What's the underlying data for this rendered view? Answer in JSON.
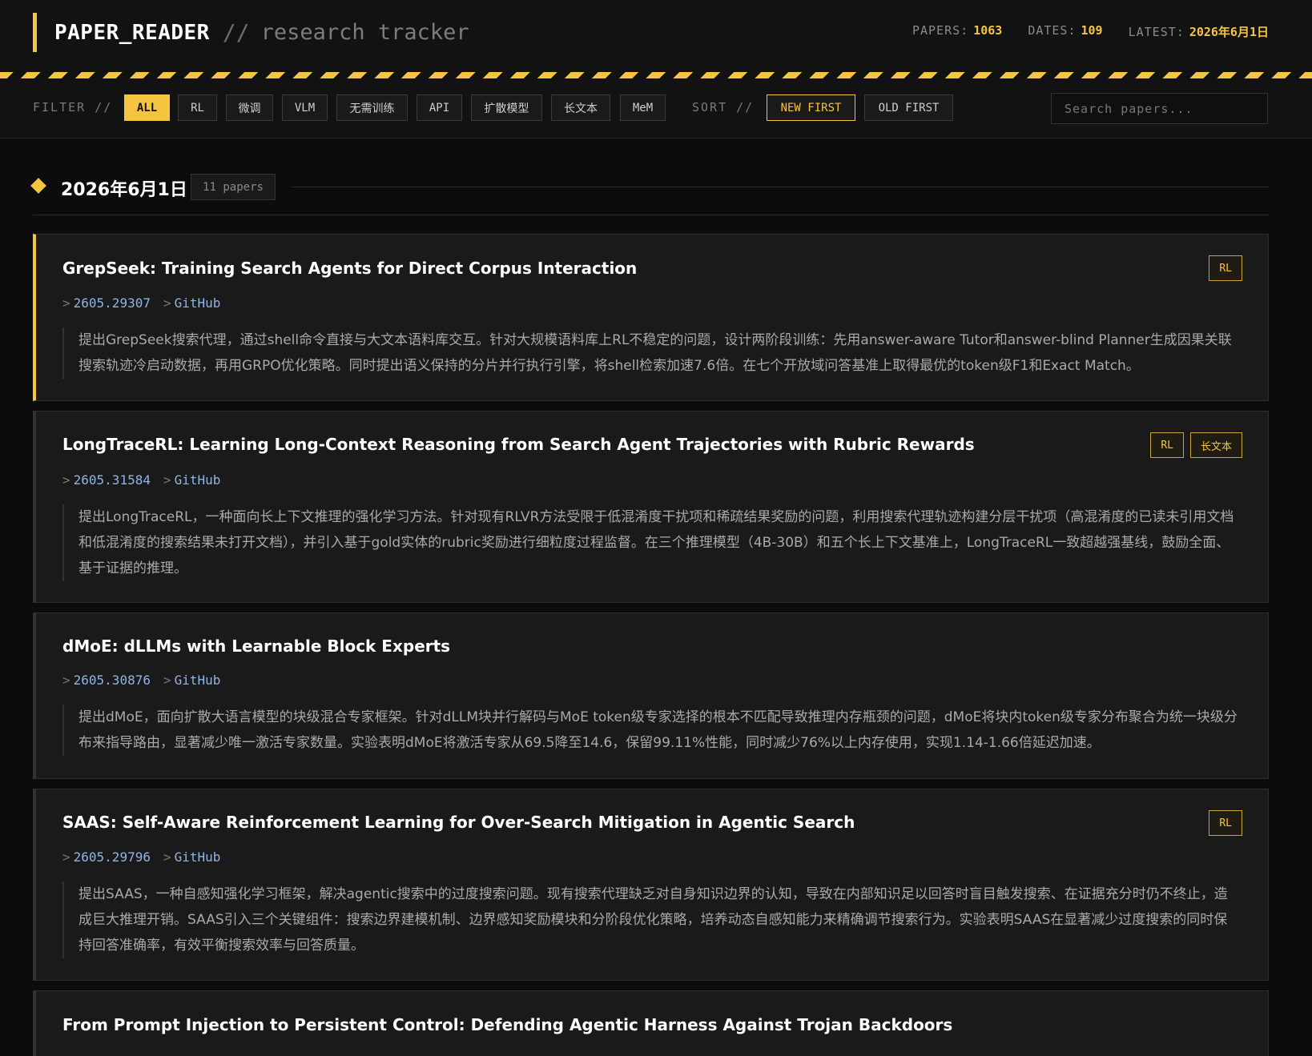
{
  "header": {
    "app_name": "PAPER_READER",
    "separator": "//",
    "subtitle": "research tracker",
    "stats": {
      "papers_label": "PAPERS:",
      "papers_value": "1063",
      "dates_label": "DATES:",
      "dates_value": "109",
      "latest_label": "LATEST:",
      "latest_value": "2026年6月1日"
    }
  },
  "filterbar": {
    "filter_label": "FILTER //",
    "filters": [
      "ALL",
      "RL",
      "微调",
      "VLM",
      "无需训练",
      "API",
      "扩散模型",
      "长文本",
      "MeM"
    ],
    "active_filter": "ALL",
    "sort_label": "SORT //",
    "sort_options": [
      "NEW FIRST",
      "OLD FIRST"
    ],
    "active_sort": "NEW FIRST",
    "search_placeholder": "Search papers..."
  },
  "date_group": {
    "date": "2026年6月1日",
    "count": "11 papers"
  },
  "papers": [
    {
      "title": "GrepSeek: Training Search Agents for Direct Corpus Interaction",
      "arxiv": "2605.29307",
      "github": "GitHub",
      "summary": "提出GrepSeek搜索代理，通过shell命令直接与大文本语料库交互。针对大规模语料库上RL不稳定的问题，设计两阶段训练：先用answer-aware Tutor和answer-blind Planner生成因果关联搜索轨迹冷启动数据，再用GRPO优化策略。同时提出语义保持的分片并行执行引擎，将shell检索加速7.6倍。在七个开放域问答基准上取得最优的token级F1和Exact Match。",
      "tags": [
        "RL"
      ]
    },
    {
      "title": "LongTraceRL: Learning Long-Context Reasoning from Search Agent Trajectories with Rubric Rewards",
      "arxiv": "2605.31584",
      "github": "GitHub",
      "summary": "提出LongTraceRL，一种面向长上下文推理的强化学习方法。针对现有RLVR方法受限于低混淆度干扰项和稀疏结果奖励的问题，利用搜索代理轨迹构建分层干扰项（高混淆度的已读未引用文档和低混淆度的搜索结果未打开文档），并引入基于gold实体的rubric奖励进行细粒度过程监督。在三个推理模型（4B-30B）和五个长上下文基准上，LongTraceRL一致超越强基线，鼓励全面、基于证据的推理。",
      "tags": [
        "RL",
        "长文本"
      ]
    },
    {
      "title": "dMoE: dLLMs with Learnable Block Experts",
      "arxiv": "2605.30876",
      "github": "GitHub",
      "summary": "提出dMoE，面向扩散大语言模型的块级混合专家框架。针对dLLM块并行解码与MoE token级专家选择的根本不匹配导致推理内存瓶颈的问题，dMoE将块内token级专家分布聚合为统一块级分布来指导路由，显著减少唯一激活专家数量。实验表明dMoE将激活专家从69.5降至14.6，保留99.11%性能，同时减少76%以上内存使用，实现1.14-1.66倍延迟加速。",
      "tags": []
    },
    {
      "title": "SAAS: Self-Aware Reinforcement Learning for Over-Search Mitigation in Agentic Search",
      "arxiv": "2605.29796",
      "github": "GitHub",
      "summary": "提出SAAS，一种自感知强化学习框架，解决agentic搜索中的过度搜索问题。现有搜索代理缺乏对自身知识边界的认知，导致在内部知识足以回答时盲目触发搜索、在证据充分时仍不终止，造成巨大推理开销。SAAS引入三个关键组件：搜索边界建模机制、边界感知奖励模块和分阶段优化策略，培养动态自感知能力来精确调节搜索行为。实验表明SAAS在显著减少过度搜索的同时保持回答准确率，有效平衡搜索效率与回答质量。",
      "tags": [
        "RL"
      ]
    },
    {
      "title": "From Prompt Injection to Persistent Control: Defending Agentic Harness Against Trojan Backdoors",
      "tags": []
    }
  ]
}
